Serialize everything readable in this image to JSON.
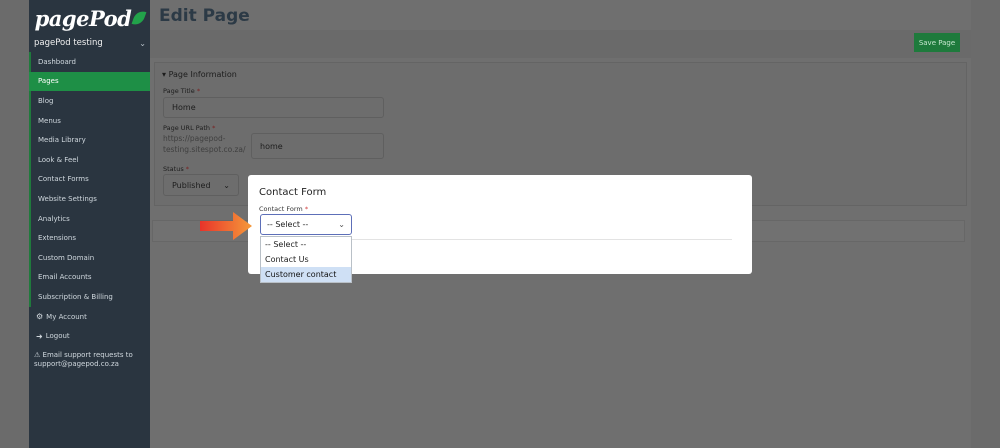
{
  "sidebar": {
    "logo": "pagePod",
    "site_name": "pagePod testing",
    "items": [
      {
        "label": "Dashboard"
      },
      {
        "label": "Pages"
      },
      {
        "label": "Blog"
      },
      {
        "label": "Menus"
      },
      {
        "label": "Media Library"
      },
      {
        "label": "Look & Feel"
      },
      {
        "label": "Contact Forms"
      },
      {
        "label": "Website Settings"
      },
      {
        "label": "Analytics"
      },
      {
        "label": "Extensions"
      },
      {
        "label": "Custom Domain"
      },
      {
        "label": "Email Accounts"
      },
      {
        "label": "Subscription & Billing"
      }
    ],
    "active_item": "Pages",
    "my_account": "My Account",
    "logout": "Logout",
    "support_line1": "Email support requests to",
    "support_line2": "support@pagepod.co.za"
  },
  "main": {
    "title": "Edit Page",
    "save_label": "Save Page",
    "section_title": "Page Information",
    "page_title_label": "Page Title",
    "page_title_value": "Home",
    "url_label": "Page URL Path",
    "url_prefix": "https://pagepod-testing.sitespot.co.za/",
    "url_value": "home",
    "status_label": "Status",
    "status_value": "Published",
    "required_marker": "*"
  },
  "modal": {
    "title": "Contact Form",
    "field_label": "Contact Form",
    "selected": "-- Select --",
    "options": [
      "-- Select --",
      "Contact Us",
      "Customer contact"
    ],
    "highlighted_option": "Customer contact"
  },
  "colors": {
    "brand_green": "#22a24a",
    "active_nav": "#1e8f46",
    "sidebar_bg": "#2a3540",
    "modal_bg": "#ffffff",
    "arrow": "#f2552c"
  },
  "icons": [
    "chevron-down-icon",
    "gear-icon",
    "logout-icon",
    "warning-icon",
    "leaf-icon",
    "arrow-right-icon"
  ]
}
